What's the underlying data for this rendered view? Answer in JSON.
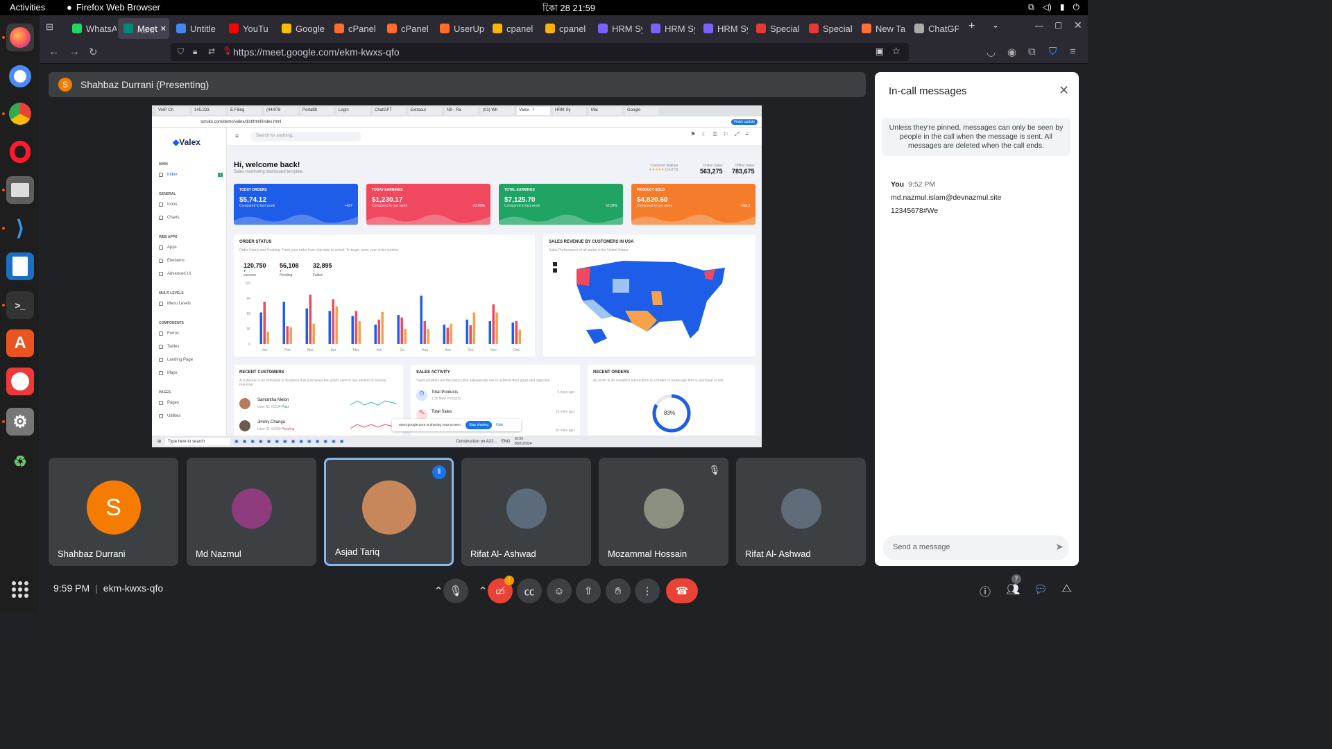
{
  "topbar": {
    "activities": "Activities",
    "app_name": "Firefox Web Browser",
    "clock": "কোি 28  21:59"
  },
  "browser": {
    "tabs": [
      {
        "label": "WhatsA",
        "color": "#25d366"
      },
      {
        "label": "Meet",
        "sub": "PLAYIN",
        "color": "#00897b",
        "active": true
      },
      {
        "label": "Untitle",
        "color": "#4285f4"
      },
      {
        "label": "YouTu",
        "color": "#ff0000"
      },
      {
        "label": "Google",
        "color": "#fbbc05"
      },
      {
        "label": "cPanel",
        "color": "#ff6c2c"
      },
      {
        "label": "cPanel",
        "color": "#ff6c2c"
      },
      {
        "label": "UserUp",
        "color": "#ff6c2c"
      },
      {
        "label": "cpanel",
        "color": "#ffb300"
      },
      {
        "label": "cpanel",
        "color": "#ffb300"
      },
      {
        "label": "HRM Sy",
        "color": "#7b61ff"
      },
      {
        "label": "HRM Sy",
        "color": "#7b61ff"
      },
      {
        "label": "HRM Sy",
        "color": "#7b61ff"
      },
      {
        "label": "Special",
        "color": "#e53935"
      },
      {
        "label": "Special",
        "color": "#e53935"
      },
      {
        "label": "New Ta",
        "color": "#ff7139"
      },
      {
        "label": "ChatGP",
        "color": "#aaaaaa"
      }
    ],
    "url": "https://meet.google.com/ekm-kwxs-qfo"
  },
  "meet": {
    "presenting_initial": "S",
    "presenting_label": "Shahbaz Durrani (Presenting)",
    "meeting_time": "9:59 PM",
    "meeting_code": "ekm-kwxs-qfo",
    "people_count": "7",
    "participants": [
      {
        "name": "Shahbaz Durrani",
        "initial": "S",
        "color": "#f57c00"
      },
      {
        "name": "Md Nazmul",
        "color": "#8e3c7d"
      },
      {
        "name": "Asjad Tariq",
        "color": "#c8875a",
        "selected": true
      },
      {
        "name": "Rifat Al- Ashwad",
        "color": "#5b6b7a"
      },
      {
        "name": "Mozammal Hossain",
        "color": "#8a8f80"
      },
      {
        "name": "Rifat Al- Ashwad",
        "color": "#5f6b78"
      }
    ]
  },
  "messages_panel": {
    "title": "In-call messages",
    "note": "Unless they're pinned, messages can only be seen by people in the call when the message is sent. All messages are deleted when the call ends.",
    "sender": "You",
    "time": "9:52 PM",
    "lines": [
      "md.nazmul.islam@devnazmul.site",
      "12345678#We"
    ],
    "input_placeholder": "Send a message"
  },
  "shared_screen": {
    "tabs": [
      "VoIP Ch",
      "145.233",
      "E-Filing",
      "(44/978",
      "PortalBl",
      "Login",
      "ChatGPT",
      "Extracur",
      "N9 - Ra",
      "(01) Wh",
      "Valex - I",
      "HRM Sy",
      "Mai",
      "Google"
    ],
    "url": "spruko.com/demo/valex/dist/html/index.html",
    "brand": "Valex",
    "search_placeholder": "Search for anything...",
    "finish_update": "Finish update",
    "welcome": "Hi, welcome back!",
    "subtitle": "Sales monitoring dashboard template.",
    "customer_ratings_label": "Customer Ratings",
    "customer_ratings_count": "(14,873)",
    "online_sales_label": "Online Sales",
    "online_sales": "563,275",
    "offline_sales_label": "Offline Sales",
    "offline_sales": "783,675",
    "sidebar": {
      "main": "MAIN",
      "index": "Index",
      "index_badge": "1",
      "general": "GENERAL",
      "icons": "Icons",
      "charts": "Charts",
      "web_apps": "WEB APPS",
      "apps": "Apps",
      "elements": "Elements",
      "advanced": "Advanced Ui",
      "multi": "MULTI LEVELS",
      "menu": "Menu Levels",
      "components": "COMPONENTS",
      "forms": "Forms",
      "tables": "Tables",
      "landing": "Landing Page",
      "maps": "Maps",
      "pages_sec": "PAGES",
      "pages": "Pages",
      "utilities": "Utilities"
    },
    "cards": [
      {
        "label": "TODAY ORDERS",
        "value": "$5,74.12",
        "sub": "Compared to last week",
        "pct": "+427",
        "color": "#1e5de8"
      },
      {
        "label": "TODAY EARNINGS",
        "value": "$1,230.17",
        "sub": "Compared to last week",
        "pct": "-23.09%",
        "color": "#f0485e"
      },
      {
        "label": "TOTAL EARNINGS",
        "value": "$7,125.70",
        "sub": "Compared to last week",
        "pct": "52.09%",
        "color": "#1fa463"
      },
      {
        "label": "PRODUCT SOLD",
        "value": "$4,820.50",
        "sub": "Compared to last week",
        "pct": "-152.3",
        "color": "#f57c2b"
      }
    ],
    "order_status": {
      "title": "ORDER STATUS",
      "subtitle": "Order Status and Tracking. Track your order from ship date to arrival. To begin, enter your order number.",
      "success": "120,750",
      "success_label": "success",
      "pending": "56,108",
      "pending_label": "Pending",
      "failed": "32,895",
      "failed_label": "Failed"
    },
    "map": {
      "title": "SALES REVENUE BY CUSTOMERS IN USA",
      "subtitle": "Sales Performance of all states in the United States."
    },
    "recent_customers": {
      "title": "RECENT CUSTOMERS",
      "subtitle": "A customer is an individual or business that purchases the goods service has evolved to include real-time",
      "c1": "Samantha Melon",
      "c1_meta": "User ID: #1234",
      "c1_status": "Paid",
      "c2": "Jimmy Changa",
      "c2_meta": "User ID: #1234",
      "c2_status": "Pending"
    },
    "sales_activity": {
      "title": "SALES ACTIVITY",
      "subtitle": "Sales activities are the tactics that salespeople use to achieve their goals and objective",
      "a1": "Total Products",
      "a1_sub": "1.3k New Products",
      "a1_time": "5 days ago",
      "a2": "Total Sales",
      "a2_time": "10 mins ago",
      "a3_time": "50 mins ago"
    },
    "recent_orders": {
      "title": "RECENT ORDERS",
      "subtitle": "An order is an investor's instructions to a broker or brokerage firm to purchase or sell",
      "pct": "83%"
    },
    "share_bar": {
      "text": "meet.google.com is sharing your screen.",
      "stop": "Stop sharing",
      "hide": "Hide"
    },
    "taskbar": {
      "search": "Type here to search",
      "weather": "Construction on A22...",
      "lang": "ENG",
      "time": "16:59",
      "date": "28/01/2024"
    }
  },
  "chart_data": {
    "type": "bar",
    "categories": [
      "Jan",
      "Feb",
      "Mar",
      "Apr",
      "May",
      "Jun",
      "Jul",
      "Aug",
      "Sep",
      "Oct",
      "Nov",
      "Dec"
    ],
    "ylim": [
      0,
      120
    ],
    "yticks": [
      "120",
      "90",
      "60",
      "30",
      "0"
    ],
    "series": [
      {
        "color": "#1e5de8",
        "values": [
          62,
          83,
          70,
          65,
          55,
          38,
          57,
          95,
          38,
          48,
          45,
          42
        ]
      },
      {
        "color": "#f0485e",
        "values": [
          83,
          35,
          97,
          88,
          65,
          48,
          52,
          45,
          32,
          37,
          78,
          45
        ]
      },
      {
        "color": "#f7a24b",
        "values": [
          24,
          33,
          40,
          74,
          45,
          63,
          30,
          30,
          40,
          62,
          62,
          28
        ]
      }
    ]
  }
}
